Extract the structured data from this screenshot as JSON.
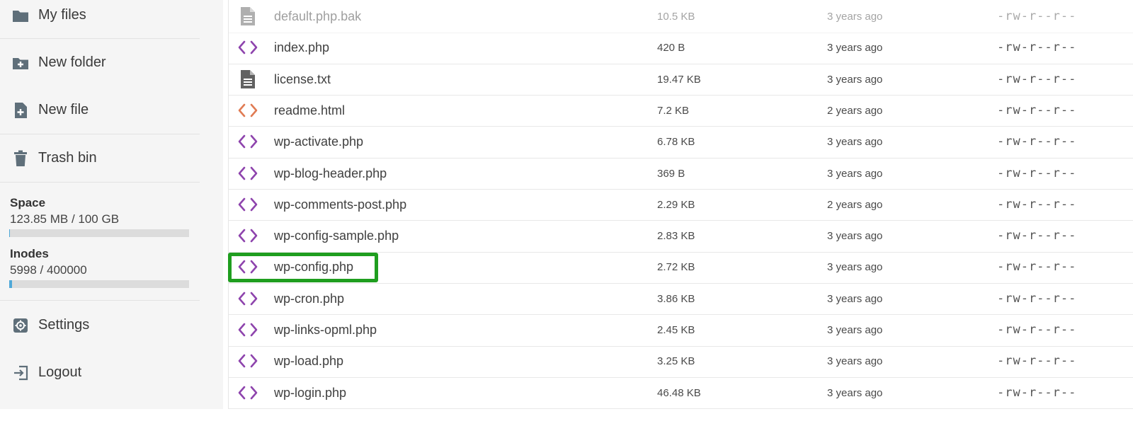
{
  "sidebar": {
    "my_files": "My files",
    "new_folder": "New folder",
    "new_file": "New file",
    "trash_bin": "Trash bin",
    "space_title": "Space",
    "space_value": "123.85 MB / 100 GB",
    "space_fraction": 0.0012,
    "inodes_title": "Inodes",
    "inodes_value": "5998 / 400000",
    "inodes_fraction": 0.015,
    "settings": "Settings",
    "logout": "Logout"
  },
  "files": [
    {
      "name": "default.php.bak",
      "size": "10.5 KB",
      "modified": "3 years ago",
      "perms": "-rw-r--r--",
      "icon": "document-icon",
      "faded": true
    },
    {
      "name": "index.php",
      "size": "420 B",
      "modified": "3 years ago",
      "perms": "-rw-r--r--",
      "icon": "code-icon"
    },
    {
      "name": "license.txt",
      "size": "19.47 KB",
      "modified": "3 years ago",
      "perms": "-rw-r--r--",
      "icon": "document-icon"
    },
    {
      "name": "readme.html",
      "size": "7.2 KB",
      "modified": "2 years ago",
      "perms": "-rw-r--r--",
      "icon": "html-code-icon"
    },
    {
      "name": "wp-activate.php",
      "size": "6.78 KB",
      "modified": "3 years ago",
      "perms": "-rw-r--r--",
      "icon": "code-icon"
    },
    {
      "name": "wp-blog-header.php",
      "size": "369 B",
      "modified": "3 years ago",
      "perms": "-rw-r--r--",
      "icon": "code-icon"
    },
    {
      "name": "wp-comments-post.php",
      "size": "2.29 KB",
      "modified": "2 years ago",
      "perms": "-rw-r--r--",
      "icon": "code-icon"
    },
    {
      "name": "wp-config-sample.php",
      "size": "2.83 KB",
      "modified": "3 years ago",
      "perms": "-rw-r--r--",
      "icon": "code-icon"
    },
    {
      "name": "wp-config.php",
      "size": "2.72 KB",
      "modified": "3 years ago",
      "perms": "-rw-r--r--",
      "icon": "code-icon",
      "highlighted": true
    },
    {
      "name": "wp-cron.php",
      "size": "3.86 KB",
      "modified": "3 years ago",
      "perms": "-rw-r--r--",
      "icon": "code-icon"
    },
    {
      "name": "wp-links-opml.php",
      "size": "2.45 KB",
      "modified": "3 years ago",
      "perms": "-rw-r--r--",
      "icon": "code-icon"
    },
    {
      "name": "wp-load.php",
      "size": "3.25 KB",
      "modified": "3 years ago",
      "perms": "-rw-r--r--",
      "icon": "code-icon"
    },
    {
      "name": "wp-login.php",
      "size": "46.48 KB",
      "modified": "3 years ago",
      "perms": "-rw-r--r--",
      "icon": "code-icon"
    }
  ],
  "colors": {
    "php_icon": "#8e44ad",
    "html_icon": "#e07b53",
    "doc_icon": "#616161",
    "highlight_border": "#1f9e1f",
    "progress_fill": "#4fa8d8"
  }
}
